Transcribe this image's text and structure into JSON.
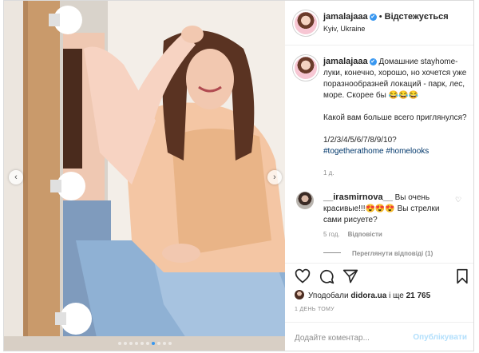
{
  "post": {
    "username": "jamalajaaa",
    "verified_mark": "✔",
    "separator": "•",
    "follow_label": "Відстежується",
    "location": "Kyiv, Ukraine"
  },
  "caption": {
    "username": "jamalajaaa",
    "lines": [
      "Домашние stayhome-луки, конечно, хорошо, но хочется уже поразнообразней локаций - парк, лес, море. Скорее бы 😂😂😂",
      "Какой вам больше всего приглянулся?",
      "1/2/3/4/5/6/7/8/9/10?"
    ],
    "hashtags": "#togetherathome #homelooks",
    "age": "1 д."
  },
  "comment": {
    "username": "__irasmirnova__",
    "text": "Вы очень красивые!!!😍😍😍 Вы стрелки сами рисуете?",
    "age": "5 год.",
    "reply_label": "Відповісти",
    "view_replies_label": "Переглянути відповіді (1)"
  },
  "likes": {
    "prefix": "Уподобали",
    "user": "didora.ua",
    "and_more": "і ще",
    "count": "21 765"
  },
  "post_time": "1 ДЕНЬ ТОМУ",
  "comment_box": {
    "placeholder": "Додайте коментар...",
    "publish_label": "Опублікувати"
  },
  "carousel": {
    "prev_symbol": "‹",
    "next_symbol": "›",
    "slide_count": 10,
    "active_index": 6
  },
  "colors": {
    "accent_blue": "#3897f0",
    "publish_disabled": "#b2dffc",
    "hashtag": "#00376b",
    "muted": "#8e8e8e"
  },
  "icons": [
    "heart-icon",
    "comment-icon",
    "share-icon",
    "bookmark-icon",
    "verified-icon",
    "small-heart-icon",
    "chevron-left-icon",
    "chevron-right-icon"
  ]
}
